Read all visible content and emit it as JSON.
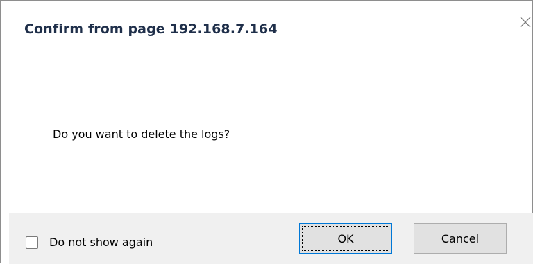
{
  "dialog": {
    "title": "Confirm from page 192.168.7.164",
    "message": "Do you want to delete the logs?",
    "close_icon": "close-icon",
    "checkbox_label": "Do not show again",
    "checkbox_checked": false,
    "ok_label": "OK",
    "cancel_label": "Cancel"
  },
  "colors": {
    "title": "#1f2f4a",
    "footer_bg": "#f0f0f0",
    "button_bg": "#e1e1e1",
    "focus_border": "#0078d7"
  }
}
